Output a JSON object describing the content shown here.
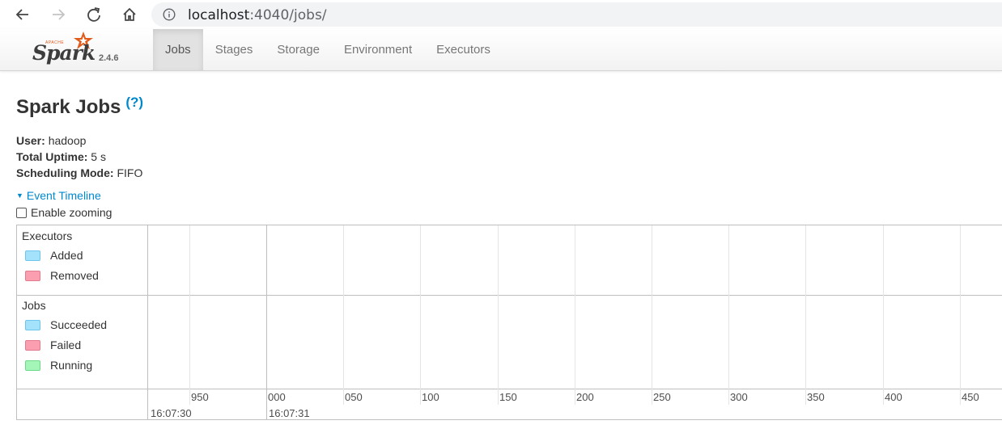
{
  "browser": {
    "url_host": "localhost",
    "url_path": ":4040/jobs/",
    "icons": [
      "back-arrow-icon",
      "forward-arrow-icon",
      "reload-icon",
      "home-icon",
      "info-icon"
    ]
  },
  "navbar": {
    "brand_apache": "APACHE",
    "brand_name": "Spark",
    "version": "2.4.6",
    "tabs": [
      {
        "label": "Jobs",
        "active": true
      },
      {
        "label": "Stages",
        "active": false
      },
      {
        "label": "Storage",
        "active": false
      },
      {
        "label": "Environment",
        "active": false
      },
      {
        "label": "Executors",
        "active": false
      }
    ]
  },
  "page": {
    "title": "Spark Jobs",
    "help": "(?)",
    "user_label": "User:",
    "user_value": "hadoop",
    "uptime_label": "Total Uptime:",
    "uptime_value": "5 s",
    "mode_label": "Scheduling Mode:",
    "mode_value": "FIFO",
    "timeline_toggle": "Event Timeline",
    "zoom_label": "Enable zooming",
    "zoom_checked": false
  },
  "timeline": {
    "executors": {
      "title": "Executors",
      "legend": [
        {
          "label": "Added",
          "fill": "#a4e1fb",
          "border": "#6ec5ec"
        },
        {
          "label": "Removed",
          "fill": "#fb9eaf",
          "border": "#e07a8c"
        }
      ]
    },
    "jobs": {
      "title": "Jobs",
      "legend": [
        {
          "label": "Succeeded",
          "fill": "#a4e1fb",
          "border": "#6ec5ec"
        },
        {
          "label": "Failed",
          "fill": "#fb9eaf",
          "border": "#e07a8c"
        },
        {
          "label": "Running",
          "fill": "#a3f5b8",
          "border": "#6fd98a"
        }
      ]
    },
    "minor_ticks": [
      "950",
      "000",
      "050",
      "100",
      "150",
      "200",
      "250",
      "300",
      "350",
      "400",
      "450"
    ],
    "major_ticks": [
      "16:07:30",
      "16:07:31"
    ]
  }
}
